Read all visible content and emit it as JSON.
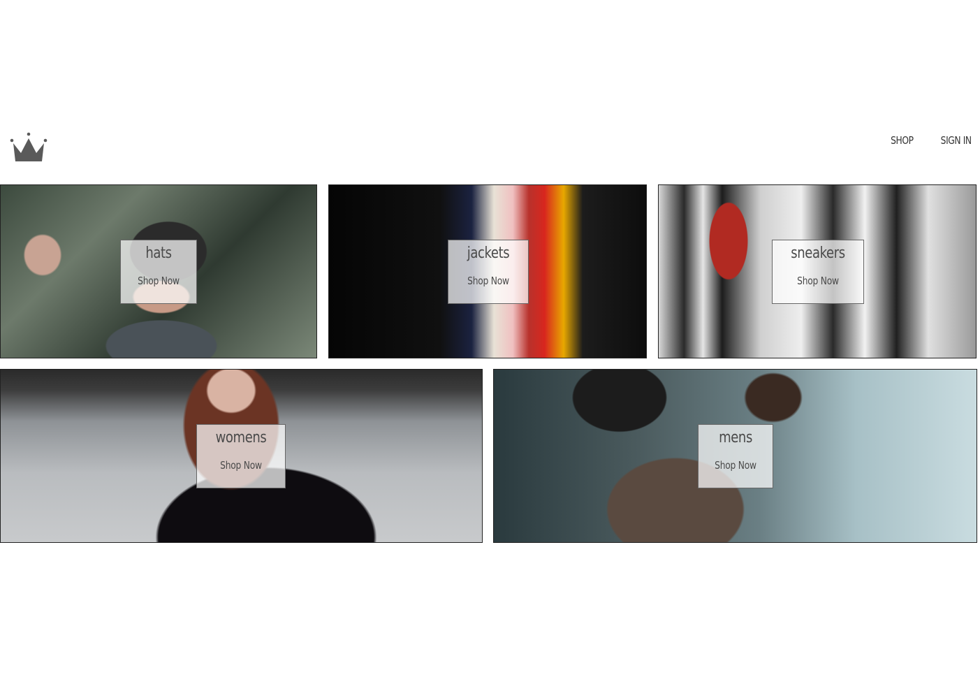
{
  "nav": {
    "shop_label": "SHOP",
    "signin_label": "SIGN IN"
  },
  "logo": {
    "icon": "crown-icon",
    "color": "#5a5a5a"
  },
  "categories": [
    {
      "title": "hats",
      "cta": "Shop Now"
    },
    {
      "title": "jackets",
      "cta": "Shop Now"
    },
    {
      "title": "sneakers",
      "cta": "Shop Now"
    },
    {
      "title": "womens",
      "cta": "Shop Now"
    },
    {
      "title": "mens",
      "cta": "Shop Now"
    }
  ]
}
